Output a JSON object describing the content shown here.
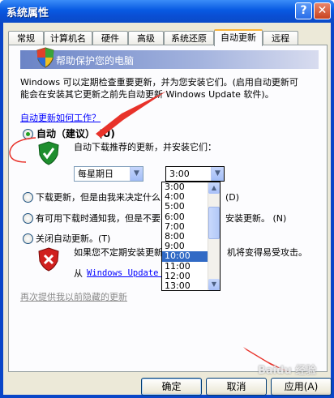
{
  "window": {
    "title": "系统属性",
    "help_glyph": "?",
    "close_glyph": "✕"
  },
  "tabs": [
    "常规",
    "计算机名",
    "硬件",
    "高级",
    "系统还原",
    "自动更新",
    "远程"
  ],
  "active_tab": "自动更新",
  "banner": {
    "label": "帮助保护您的电脑"
  },
  "intro": {
    "line1": "Windows 可以定期检查重要更新，并为您安装它们。(启用自动更新可",
    "line2": "能会在安装其它更新之前先自动更新 Windows Update 软件)。"
  },
  "how_link": "自动更新如何工作？",
  "options": {
    "auto": {
      "label": "自动（建议）",
      "accel": "(U)",
      "desc": "自动下载推荐的更新，并安装它们："
    },
    "download": {
      "label_pre": "下载更新，但是由我来决定什么",
      "label_post": "(D)"
    },
    "notify": {
      "label_pre": "有可用下载时通知我，但是不要",
      "label_post": "安装更新。 (N)"
    },
    "off": {
      "label": "关闭自动更新。",
      "accel": "(T)",
      "desc_pre": "如果您不定期安装更新，",
      "desc_post": "机将变得易受攻击。"
    }
  },
  "schedule": {
    "day": "每星期日",
    "time": "3:00"
  },
  "time_options": [
    "3:00",
    "4:00",
    "5:00",
    "6:00",
    "7:00",
    "8:00",
    "9:00",
    "10:00",
    "11:00",
    "12:00",
    "13:00"
  ],
  "selected_time": "10:00",
  "from_text": "从",
  "wu_link": "Windows Update 网",
  "reoffer_link": "再次提供我以前隐藏的更新",
  "buttons": {
    "ok": "确定",
    "cancel": "取消",
    "apply": "应用(A)"
  },
  "watermark": "Baidu 经验",
  "colors": {
    "accent": "#0a46c8",
    "selection": "#316ac5",
    "annotation": "#e8322a"
  }
}
